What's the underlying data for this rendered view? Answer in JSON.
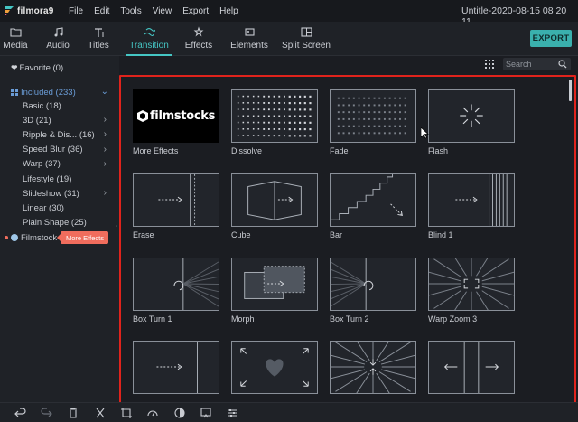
{
  "app": {
    "logo_text": "filmora9",
    "window_title": "Untitle-2020-08-15 08 20 11"
  },
  "menu": [
    "File",
    "Edit",
    "Tools",
    "View",
    "Export",
    "Help"
  ],
  "tabs": [
    {
      "label": "Media",
      "icon": "folder-icon"
    },
    {
      "label": "Audio",
      "icon": "music-note-icon"
    },
    {
      "label": "Titles",
      "icon": "text-icon"
    },
    {
      "label": "Transition",
      "icon": "transition-icon",
      "active": true
    },
    {
      "label": "Effects",
      "icon": "effects-icon"
    },
    {
      "label": "Elements",
      "icon": "elements-icon"
    },
    {
      "label": "Split Screen",
      "icon": "split-screen-icon"
    }
  ],
  "export_label": "EXPORT",
  "sidebar": {
    "favorite": "Favorite (0)",
    "included": "Included (233)",
    "items": [
      {
        "label": "Basic (18)",
        "has_children": false
      },
      {
        "label": "3D (21)",
        "has_children": true
      },
      {
        "label": "Ripple & Dis... (16)",
        "has_children": true
      },
      {
        "label": "Speed Blur (36)",
        "has_children": true
      },
      {
        "label": "Warp (37)",
        "has_children": true
      },
      {
        "label": "Lifestyle (19)",
        "has_children": false
      },
      {
        "label": "Slideshow (31)",
        "has_children": true
      },
      {
        "label": "Linear (30)",
        "has_children": false
      },
      {
        "label": "Plain Shape (25)",
        "has_children": false
      }
    ],
    "filmstock": "Filmstock",
    "more_effects_badge": "More Effects"
  },
  "search": {
    "placeholder": "Search"
  },
  "filmstocks_logo_text": "filmstocks",
  "tiles": [
    {
      "label": "More Effects",
      "type": "filmstocks"
    },
    {
      "label": "Dissolve",
      "type": "dissolve"
    },
    {
      "label": "Fade",
      "type": "fade"
    },
    {
      "label": "Flash",
      "type": "flash"
    },
    {
      "label": "Erase",
      "type": "erase"
    },
    {
      "label": "Cube",
      "type": "cube"
    },
    {
      "label": "Bar",
      "type": "bar"
    },
    {
      "label": "Blind 1",
      "type": "blind"
    },
    {
      "label": "Box Turn 1",
      "type": "boxturn1"
    },
    {
      "label": "Morph",
      "type": "morph"
    },
    {
      "label": "Box Turn 2",
      "type": "boxturn2"
    },
    {
      "label": "Warp Zoom 3",
      "type": "warpzoom"
    },
    {
      "label": "",
      "type": "slide"
    },
    {
      "label": "",
      "type": "heart"
    },
    {
      "label": "",
      "type": "burst"
    },
    {
      "label": "",
      "type": "split"
    }
  ],
  "colors": {
    "accent": "#45c6c4",
    "highlight": "#e0231c",
    "badge": "#f06d5d"
  }
}
